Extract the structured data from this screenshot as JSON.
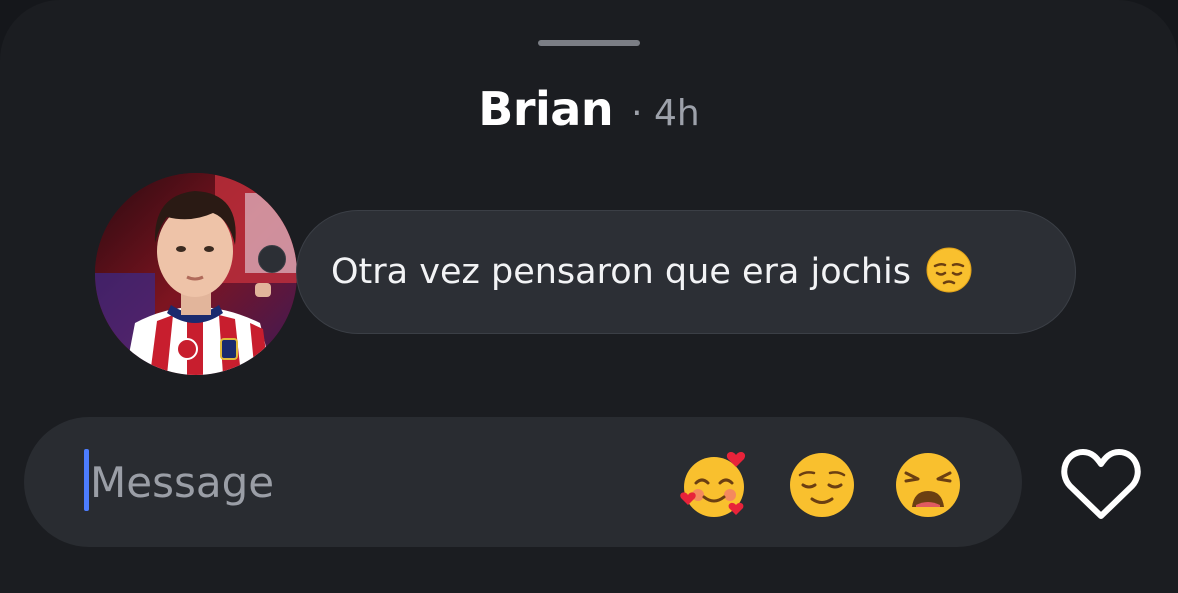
{
  "header": {
    "sender_name": "Brian",
    "time_ago": "· 4h"
  },
  "avatar": {
    "description_icon": "profile-photo"
  },
  "message": {
    "text": "Otra vez pensaron que era jochis",
    "emoji_icon": "pensive-face-icon"
  },
  "composer": {
    "placeholder": "Message",
    "quick_reactions": [
      {
        "icon": "smiling-face-with-hearts-icon"
      },
      {
        "icon": "relieved-face-icon"
      },
      {
        "icon": "weary-face-icon"
      }
    ],
    "like_icon": "heart-outline-icon"
  },
  "colors": {
    "background": "#1b1d21",
    "bubble": "#2c2f35",
    "composer": "#292c31",
    "caret": "#4c7dff",
    "emoji_yellow": "#f9c02e",
    "heart_red": "#e8233a"
  }
}
